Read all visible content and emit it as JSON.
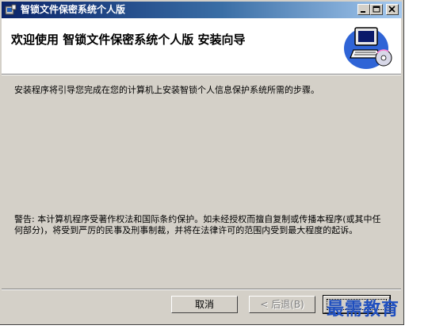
{
  "window": {
    "title": "智锁文件保密系统个人版",
    "icon": "installer-icon"
  },
  "title_buttons": {
    "minimize_icon": "minimize-icon",
    "maximize_icon": "maximize-icon",
    "close_icon": "close-icon"
  },
  "header": {
    "title": "欢迎使用 智锁文件保密系统个人版 安装向导",
    "art_icon": "computer-cd-icon"
  },
  "body": {
    "intro": "安装程序将引导您完成在您的计算机上安装智锁个人信息保护系统所需的步骤。",
    "warning": "警告: 本计算机程序受著作权法和国际条约保护。如未经授权而擅自复制或传播本程序(或其中任何部分)，将受到严厉的民事及刑事制裁，并将在法律许可的范围内受到最大程度的起诉。"
  },
  "buttons": {
    "cancel": "取消",
    "back": "< 后退(B)",
    "next": ""
  },
  "watermark": "最需教育",
  "colors": {
    "face": "#d4d0c8",
    "title_start": "#0a246a",
    "title_end": "#a6caf0",
    "watermark": "#1f4fbf"
  }
}
